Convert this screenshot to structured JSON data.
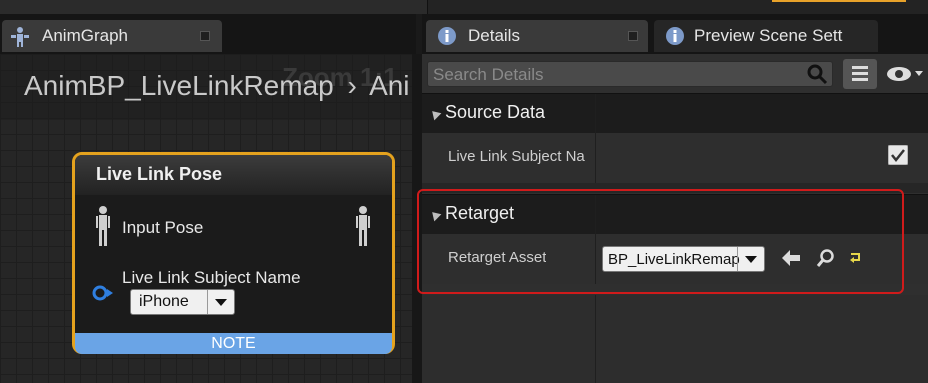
{
  "left_tab": {
    "label": "AnimGraph"
  },
  "graph": {
    "breadcrumb_root": "AnimBP_LiveLinkRemap",
    "breadcrumb_sep": "›",
    "breadcrumb_child": "Ani",
    "zoom_label": "Zoom 1:1"
  },
  "node": {
    "title": "Live Link Pose",
    "input_pose_label": "Input Pose",
    "subject_label": "Live Link Subject Name",
    "subject_value": "iPhone",
    "note": "NOTE"
  },
  "right_tabs": [
    {
      "label": "Details"
    },
    {
      "label": "Preview Scene Sett"
    }
  ],
  "details": {
    "search_placeholder": "Search Details",
    "sections": [
      {
        "title": "Source Data",
        "property": "Live Link Subject Na"
      },
      {
        "title": "Retarget",
        "property": "Retarget Asset",
        "value": "BP_LiveLinkRemap"
      }
    ]
  },
  "colors": {
    "node_border": "#e4a21e",
    "note_bar": "#6aa4e6",
    "highlight": "#d01b1b",
    "accent_orange": "#e8a22a"
  }
}
